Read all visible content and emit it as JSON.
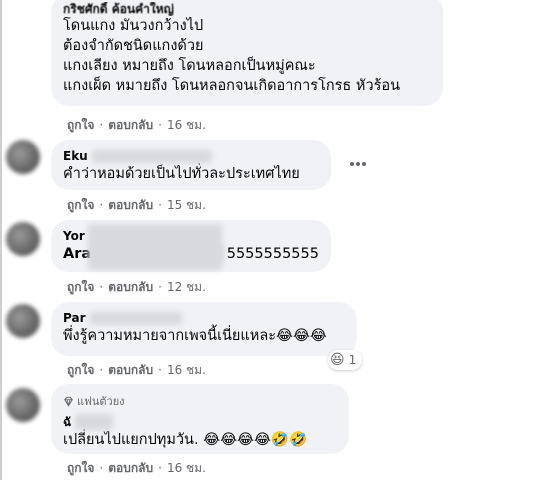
{
  "comments": [
    {
      "author": "กริชศักดิ์ ค้อนคำใหญ่",
      "lines": [
        "โดนแกง มันวงกว้างไป",
        "ต้องจำกัดชนิดแกงด้วย",
        "แกงเลียง หมายถึง โดนหลอกเป็นหมู่คณะ",
        "แกงเผ็ด หมายถึง โดนหลอกจนเกิดอาการโกรธ หัวร้อน"
      ],
      "like": "ถูกใจ",
      "reply": "ตอบกลับ",
      "time": "16 ชม."
    },
    {
      "author": "Eku",
      "lines": [
        "คำว่าหอมด้วยเป็นไปทั่วละประเทศไทย"
      ],
      "like": "ถูกใจ",
      "reply": "ตอบกลับ",
      "time": "15 ชม."
    },
    {
      "author": "Yor",
      "lines": [
        "Ara",
        "5555555555"
      ],
      "like": "ถูกใจ",
      "reply": "ตอบกลับ",
      "time": "12 ชม."
    },
    {
      "author": "Par",
      "lines": [
        "พึ่งรู้ความหมายจากเพจนี้เนี่ยแหละ😂😂😂"
      ],
      "reaction_count": "1",
      "like": "ถูกใจ",
      "reply": "ตอบกลับ",
      "time": "16 ชม."
    },
    {
      "badge": "แฟนตัวยง",
      "author": "ฉั",
      "lines": [
        "เปลี่ยนไปแยกปทุมวัน. 😂😂😂😂🤣🤣"
      ],
      "like": "ถูกใจ",
      "reply": "ตอบกลับ",
      "time": "16 ชม."
    }
  ],
  "separator": "·",
  "icons": {
    "more": "more-options-icon",
    "haha": "haha-reaction-icon",
    "badge": "diamond-icon"
  },
  "colors": {
    "bubble": "#f0f2f5",
    "meta": "#65676b",
    "text": "#050505"
  }
}
